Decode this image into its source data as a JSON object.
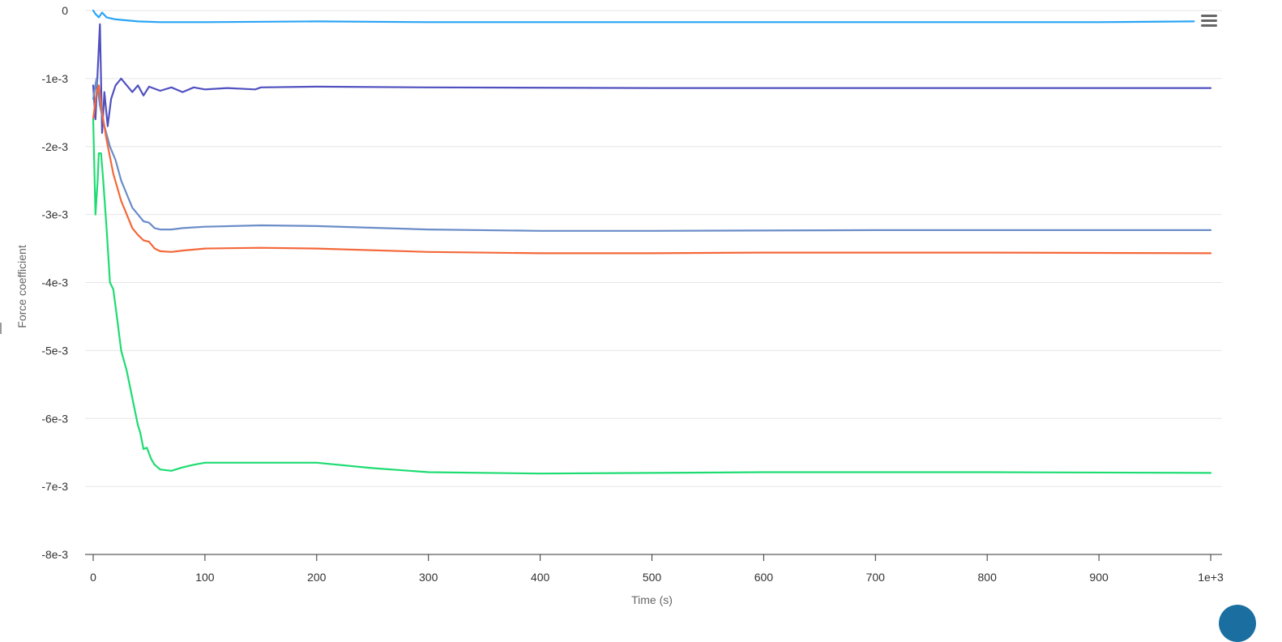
{
  "chart_data": {
    "type": "line",
    "title": "",
    "xlabel": "Time (s)",
    "ylabel": "Force coefficient",
    "xlim": [
      0,
      1000
    ],
    "ylim": [
      -0.008,
      0
    ],
    "x_ticks": [
      0,
      100,
      200,
      300,
      400,
      500,
      600,
      700,
      800,
      900,
      1000
    ],
    "x_tick_labels": [
      "0",
      "100",
      "200",
      "300",
      "400",
      "500",
      "600",
      "700",
      "800",
      "900",
      "1e+3"
    ],
    "y_ticks": [
      0,
      -0.001,
      -0.002,
      -0.003,
      -0.004,
      -0.005,
      -0.006,
      -0.007,
      -0.008
    ],
    "y_tick_labels": [
      "0",
      "-1e-3",
      "-2e-3",
      "-3e-3",
      "-4e-3",
      "-5e-3",
      "-6e-3",
      "-7e-3",
      "-8e-3"
    ],
    "grid": "horizontal",
    "legend": "none",
    "series": [
      {
        "color": "#2aa4f4",
        "points": [
          [
            0,
            0
          ],
          [
            2,
            -5e-05
          ],
          [
            5,
            -0.0001
          ],
          [
            8,
            -3e-05
          ],
          [
            12,
            -0.0001
          ],
          [
            20,
            -0.00013
          ],
          [
            40,
            -0.00016
          ],
          [
            60,
            -0.00017
          ],
          [
            100,
            -0.00017
          ],
          [
            200,
            -0.00016
          ],
          [
            300,
            -0.00017
          ],
          [
            500,
            -0.00017
          ],
          [
            700,
            -0.00017
          ],
          [
            900,
            -0.00017
          ],
          [
            985,
            -0.00016
          ]
        ]
      },
      {
        "color": "#5050c0",
        "points": [
          [
            0,
            -0.0011
          ],
          [
            2,
            -0.0016
          ],
          [
            4,
            -0.0009
          ],
          [
            6,
            -0.0002
          ],
          [
            8,
            -0.0018
          ],
          [
            10,
            -0.0012
          ],
          [
            13,
            -0.0017
          ],
          [
            16,
            -0.0013
          ],
          [
            20,
            -0.0011
          ],
          [
            25,
            -0.001
          ],
          [
            30,
            -0.0011
          ],
          [
            35,
            -0.0012
          ],
          [
            40,
            -0.0011
          ],
          [
            45,
            -0.00125
          ],
          [
            50,
            -0.00112
          ],
          [
            60,
            -0.00118
          ],
          [
            70,
            -0.00113
          ],
          [
            80,
            -0.0012
          ],
          [
            90,
            -0.00113
          ],
          [
            100,
            -0.00116
          ],
          [
            120,
            -0.00114
          ],
          [
            145,
            -0.00116
          ],
          [
            150,
            -0.00113
          ],
          [
            200,
            -0.00112
          ],
          [
            300,
            -0.00113
          ],
          [
            500,
            -0.00114
          ],
          [
            700,
            -0.00114
          ],
          [
            900,
            -0.00114
          ],
          [
            1000,
            -0.00114
          ]
        ]
      },
      {
        "color": "#6a8cc8",
        "points": [
          [
            0,
            -0.0013
          ],
          [
            3,
            -0.001
          ],
          [
            6,
            -0.0014
          ],
          [
            10,
            -0.0017
          ],
          [
            15,
            -0.002
          ],
          [
            20,
            -0.0022
          ],
          [
            25,
            -0.0025
          ],
          [
            30,
            -0.0027
          ],
          [
            35,
            -0.0029
          ],
          [
            40,
            -0.003
          ],
          [
            45,
            -0.0031
          ],
          [
            50,
            -0.00312
          ],
          [
            55,
            -0.0032
          ],
          [
            60,
            -0.00322
          ],
          [
            70,
            -0.00322
          ],
          [
            80,
            -0.0032
          ],
          [
            100,
            -0.00318
          ],
          [
            150,
            -0.00316
          ],
          [
            200,
            -0.00317
          ],
          [
            300,
            -0.00322
          ],
          [
            400,
            -0.00324
          ],
          [
            500,
            -0.00324
          ],
          [
            700,
            -0.00323
          ],
          [
            900,
            -0.00323
          ],
          [
            1000,
            -0.00323
          ]
        ]
      },
      {
        "color": "#f4683a",
        "points": [
          [
            0,
            -0.0016
          ],
          [
            3,
            -0.0012
          ],
          [
            5,
            -0.0011
          ],
          [
            8,
            -0.0015
          ],
          [
            12,
            -0.0019
          ],
          [
            18,
            -0.0024
          ],
          [
            25,
            -0.0028
          ],
          [
            30,
            -0.003
          ],
          [
            35,
            -0.0032
          ],
          [
            40,
            -0.0033
          ],
          [
            45,
            -0.00338
          ],
          [
            50,
            -0.0034
          ],
          [
            55,
            -0.0035
          ],
          [
            60,
            -0.00354
          ],
          [
            70,
            -0.00355
          ],
          [
            80,
            -0.00353
          ],
          [
            100,
            -0.0035
          ],
          [
            150,
            -0.00349
          ],
          [
            200,
            -0.0035
          ],
          [
            300,
            -0.00355
          ],
          [
            400,
            -0.00357
          ],
          [
            500,
            -0.00357
          ],
          [
            600,
            -0.00356
          ],
          [
            800,
            -0.00356
          ],
          [
            1000,
            -0.00357
          ]
        ]
      },
      {
        "color": "#1edc72",
        "points": [
          [
            0,
            -0.0016
          ],
          [
            2,
            -0.003
          ],
          [
            4,
            -0.0025
          ],
          [
            5,
            -0.0021
          ],
          [
            7,
            -0.0021
          ],
          [
            9,
            -0.0025
          ],
          [
            12,
            -0.0032
          ],
          [
            15,
            -0.004
          ],
          [
            18,
            -0.0041
          ],
          [
            22,
            -0.0046
          ],
          [
            25,
            -0.005
          ],
          [
            30,
            -0.0053
          ],
          [
            35,
            -0.0057
          ],
          [
            40,
            -0.0061
          ],
          [
            42,
            -0.0062
          ],
          [
            45,
            -0.00645
          ],
          [
            48,
            -0.00643
          ],
          [
            52,
            -0.0066
          ],
          [
            55,
            -0.00668
          ],
          [
            60,
            -0.00675
          ],
          [
            70,
            -0.00677
          ],
          [
            80,
            -0.00672
          ],
          [
            90,
            -0.00668
          ],
          [
            100,
            -0.00665
          ],
          [
            150,
            -0.00665
          ],
          [
            200,
            -0.00665
          ],
          [
            250,
            -0.00673
          ],
          [
            300,
            -0.00679
          ],
          [
            400,
            -0.00681
          ],
          [
            500,
            -0.0068
          ],
          [
            600,
            -0.00679
          ],
          [
            800,
            -0.00679
          ],
          [
            1000,
            -0.0068
          ]
        ]
      }
    ]
  },
  "ui": {
    "menu_icon": "hamburger-menu-icon"
  }
}
